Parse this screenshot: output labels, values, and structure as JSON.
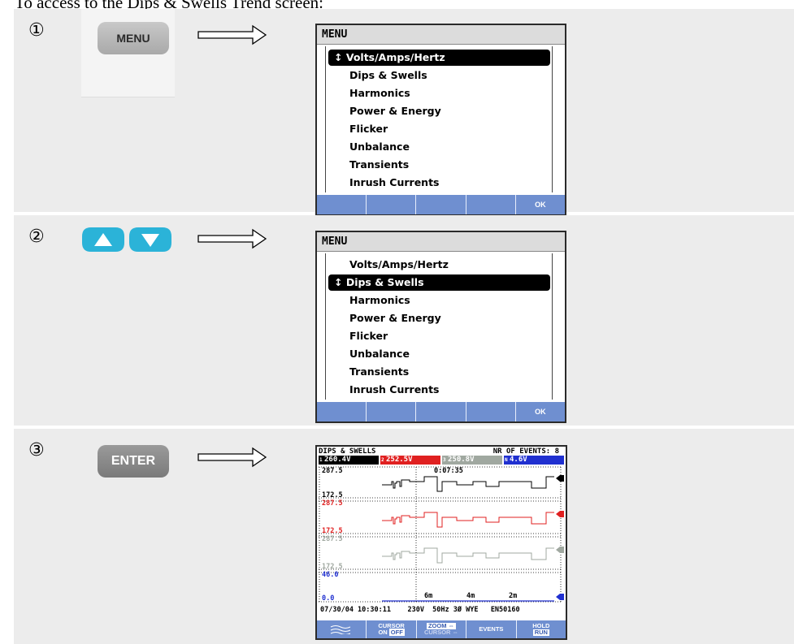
{
  "intro": "To access to the Dips & Swells Trend screen:",
  "steps": [
    {
      "number": "①",
      "key": "MENU",
      "screen": {
        "title": "MENU",
        "items": [
          "↕ Volts/Amps/Hertz",
          "Dips & Swells",
          "Harmonics",
          "Power & Energy",
          "Flicker",
          "Unbalance",
          "Transients",
          "Inrush Currents"
        ],
        "selected_index": 0,
        "softkeys": [
          "",
          "",
          "",
          "",
          "OK"
        ]
      }
    },
    {
      "number": "②",
      "key_icons": [
        "arrow-up-icon",
        "arrow-down-icon"
      ],
      "screen": {
        "title": "MENU",
        "items": [
          "Volts/Amps/Hertz",
          "↕ Dips & Swells",
          "Harmonics",
          "Power & Energy",
          "Flicker",
          "Unbalance",
          "Transients",
          "Inrush Currents"
        ],
        "selected_index": 1,
        "softkeys": [
          "",
          "",
          "",
          "",
          "OK"
        ]
      }
    },
    {
      "number": "③",
      "key": "ENTER",
      "scope": {
        "title": "DIPS & SWELLS",
        "events": "NR OF EVENTS:  8",
        "readings": [
          {
            "phase": "1",
            "value": "260.4V",
            "color": "#000000"
          },
          {
            "phase": "2",
            "value": "252.5V",
            "color": "#e02020"
          },
          {
            "phase": "3",
            "value": "250.8V",
            "color": "#a0a8a0"
          },
          {
            "phase": "N",
            "value": "4.6V",
            "color": "#2030d0"
          }
        ],
        "y_labels": {
          "ch1_top": "287.5",
          "ch1_bot": "172.5",
          "ch2_top": "287.5",
          "ch2_bot": "172.5",
          "ch3_top": "287.5",
          "ch3_bot": "172.5",
          "n_top": "46.0",
          "n_bot": "0.0"
        },
        "cursor_time": "0:07:35",
        "time_ticks": [
          "6m",
          "4m",
          "2m"
        ],
        "status": "07/30/04 10:30:11    230V  50Hz 3Ø WYE   EN50160",
        "softkeys": [
          {
            "top": "",
            "bottom": ""
          },
          {
            "top": "CURSOR",
            "bottom_a": "ON",
            "bottom_b": "OFF"
          },
          {
            "top": "ZOOM ⇔",
            "bottom": "CURSOR ⇔"
          },
          {
            "top": "EVENTS",
            "bottom": ""
          },
          {
            "top": "HOLD",
            "bottom": "RUN"
          }
        ]
      }
    }
  ]
}
